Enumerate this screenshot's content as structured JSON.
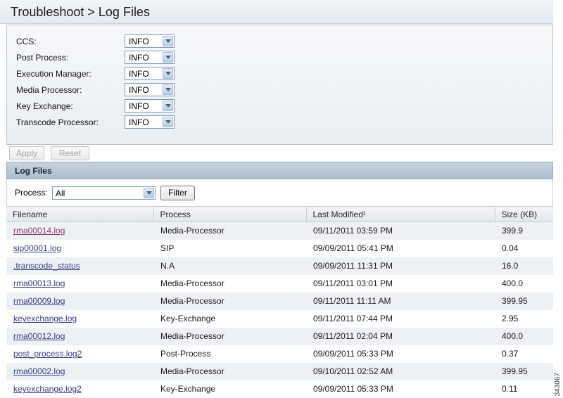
{
  "page": {
    "title": "Troubleshoot > Log Files"
  },
  "settings": [
    {
      "label": "CCS:",
      "value": "INFO"
    },
    {
      "label": "Post Process:",
      "value": "INFO"
    },
    {
      "label": "Execution Manager:",
      "value": "INFO"
    },
    {
      "label": "Media Processor:",
      "value": "INFO"
    },
    {
      "label": "Key Exchange:",
      "value": "INFO"
    },
    {
      "label": "Transcode Processor:",
      "value": "INFO"
    }
  ],
  "buttons": {
    "apply": "Apply",
    "reset": "Reset"
  },
  "log_files": {
    "header": "Log Files",
    "process_label": "Process:",
    "process_value": "All",
    "filter_label": "Filter",
    "columns": [
      "Filename",
      "Process",
      "Last Modified¹",
      "Size (KB)"
    ],
    "rows": [
      {
        "filename": "rma00014.log",
        "process": "Media-Processor",
        "modified": "09/11/2011 03:59 PM",
        "size": "399.9"
      },
      {
        "filename": "sip00001.log",
        "process": "SIP",
        "modified": "09/09/2011 05:41 PM",
        "size": "0.04"
      },
      {
        "filename": ".transcode_status",
        "process": "N.A",
        "modified": "09/09/2011 11:31 PM",
        "size": "16.0"
      },
      {
        "filename": "rma00013.log",
        "process": "Media-Processor",
        "modified": "09/11/2011 03:01 PM",
        "size": "400.0"
      },
      {
        "filename": "rma00009.log",
        "process": "Media-Processor",
        "modified": "09/11/2011 11:11 AM",
        "size": "399.95"
      },
      {
        "filename": "keyexchange.log",
        "process": "Key-Exchange",
        "modified": "09/11/2011 07:44 PM",
        "size": "2.95"
      },
      {
        "filename": "rma00012.log",
        "process": "Media-Processor",
        "modified": "09/11/2011 02:04 PM",
        "size": "400.0"
      },
      {
        "filename": "post_process.log2",
        "process": "Post-Process",
        "modified": "09/09/2011 05:33 PM",
        "size": "0.37"
      },
      {
        "filename": "rma00002.log",
        "process": "Media-Processor",
        "modified": "09/10/2011 02:52 AM",
        "size": "399.95"
      },
      {
        "filename": "keyexchange.log2",
        "process": "Key-Exchange",
        "modified": "09/09/2011 05:33 PM",
        "size": "0.11"
      }
    ]
  },
  "side_id": "343067",
  "colors": {
    "link": "#3a3c8c",
    "visited_link": "#8b3a6e",
    "header_bg": "#aebfcd"
  }
}
